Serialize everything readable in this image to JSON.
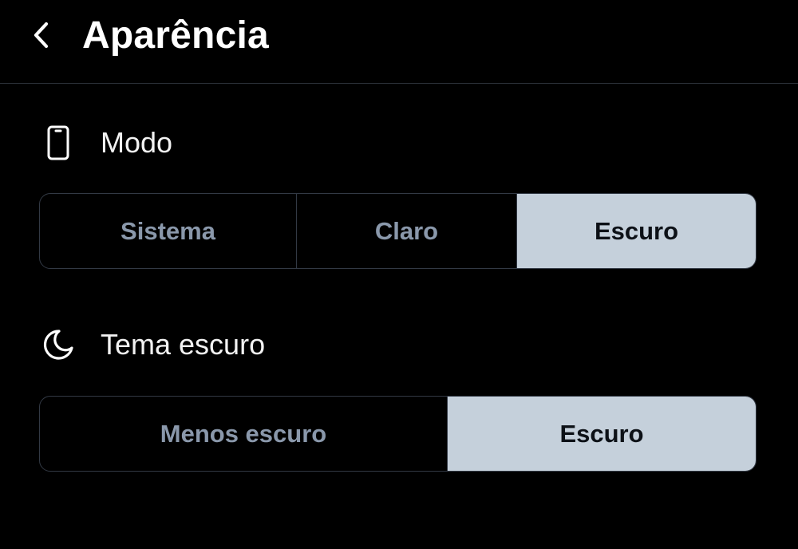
{
  "header": {
    "title": "Aparência",
    "back_icon": "chevron-left-icon"
  },
  "mode": {
    "label": "Modo",
    "icon": "phone-icon",
    "options": [
      "Sistema",
      "Claro",
      "Escuro"
    ],
    "selected": "Escuro"
  },
  "dark_theme": {
    "label": "Tema escuro",
    "icon": "moon-icon",
    "options": [
      "Menos escuro",
      "Escuro"
    ],
    "selected": "Escuro"
  },
  "colors": {
    "background": "#000000",
    "selected_segment": "#c5d0db",
    "unselected_text": "#8a98ab",
    "border": "#323944"
  }
}
